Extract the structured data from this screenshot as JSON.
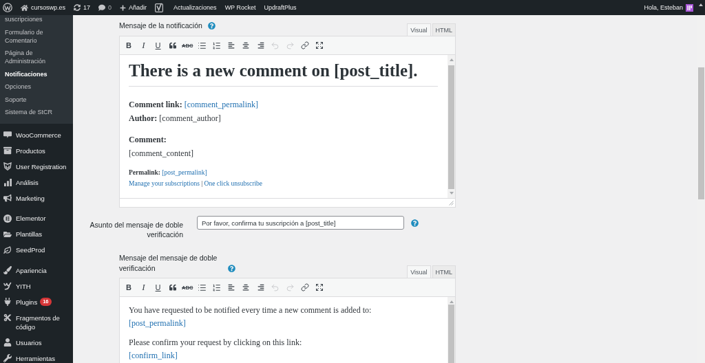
{
  "admin_bar": {
    "site_name": "cursoswp.es",
    "updates": "17",
    "comments": "0",
    "new_label": "Añadir",
    "links": [
      "Actualizaciones",
      "WP Rocket",
      "UpdraftPlus"
    ],
    "greeting": "Hola, Esteban"
  },
  "sidebar": {
    "submenu": [
      {
        "label": "suscripciones",
        "selected": false
      },
      {
        "label": "Formulario de Comentario",
        "selected": false
      },
      {
        "label": "Página de Administración",
        "selected": false
      },
      {
        "label": "Notificaciones",
        "selected": true
      },
      {
        "label": "Opciones",
        "selected": false
      },
      {
        "label": "Soporte",
        "selected": false
      },
      {
        "label": "Sistema de StCR",
        "selected": false
      }
    ],
    "menu_groups": [
      [
        {
          "label": "WooCommerce"
        },
        {
          "label": "Productos"
        },
        {
          "label": "User Registration"
        },
        {
          "label": "Análisis"
        },
        {
          "label": "Marketing"
        }
      ],
      [
        {
          "label": "Elementor"
        },
        {
          "label": "Plantillas"
        },
        {
          "label": "SeedProd"
        }
      ],
      [
        {
          "label": "Apariencia"
        },
        {
          "label": "YITH"
        },
        {
          "label": "Plugins",
          "badge": "16"
        },
        {
          "label": "Fragmentos de código"
        },
        {
          "label": "Usuarios"
        },
        {
          "label": "Herramientas"
        }
      ]
    ]
  },
  "notification_message": {
    "label": "Mensaje de la notificación",
    "tabs": [
      {
        "label": "Visual",
        "selected": true
      },
      {
        "label": "HTML",
        "selected": false
      }
    ],
    "toolbar": [
      {
        "kind": "bold",
        "label": "B",
        "disabled": false
      },
      {
        "kind": "italic",
        "label": "I",
        "disabled": false
      },
      {
        "kind": "underline",
        "label": "U",
        "disabled": false
      },
      {
        "kind": "quote",
        "disabled": false
      },
      {
        "kind": "strikethrough",
        "label": "ABC",
        "disabled": false
      },
      {
        "kind": "bullet_list",
        "disabled": false
      },
      {
        "kind": "numbered_list",
        "disabled": false
      },
      {
        "kind": "align_left",
        "disabled": false
      },
      {
        "kind": "align_center",
        "disabled": false
      },
      {
        "kind": "align_right",
        "disabled": false
      },
      {
        "kind": "undo",
        "disabled": true
      },
      {
        "kind": "redo",
        "disabled": true
      },
      {
        "kind": "link",
        "disabled": false
      },
      {
        "kind": "fullscreen",
        "disabled": false
      }
    ],
    "blocks": [
      {
        "kind": "heading",
        "text": "There is a new comment on [post_title]."
      },
      {
        "kind": "rule"
      },
      {
        "kind": "paragraph",
        "lines": [
          [
            {
              "kind": "label",
              "text": "Comment link:"
            },
            {
              "kind": "link",
              "text": "[comment_permalink]"
            }
          ],
          [
            {
              "kind": "text",
              "text": "**Author:** [comment_author]"
            }
          ]
        ]
      },
      {
        "kind": "paragraph",
        "lines": [
          [
            {
              "kind": "label",
              "text": "Comment:"
            }
          ],
          [
            {
              "kind": "text",
              "text": "[comment_content]"
            }
          ]
        ]
      },
      {
        "kind": "small",
        "lines": [
          [
            {
              "kind": "label",
              "text": "Permalink:"
            },
            {
              "kind": "link",
              "text": "[post_permalink]"
            }
          ],
          [
            {
              "kind": "link",
              "text": "Manage your subscriptions"
            },
            {
              "kind": "text",
              "text": "|"
            },
            {
              "kind": "link",
              "text": "One click unsubscribe"
            }
          ]
        ]
      }
    ]
  },
  "confirmation_subject": {
    "label": "Asunto del mensaje de doble verificación",
    "value": "Por favor, confirma tu suscripción a [post_title]"
  },
  "confirmation_message": {
    "label": "Mensaje del mensaje de doble verificación",
    "tabs": [
      {
        "label": "Visual",
        "selected": true
      },
      {
        "label": "HTML",
        "selected": false
      }
    ],
    "toolbar": [
      {
        "kind": "bold",
        "label": "B",
        "disabled": false
      },
      {
        "kind": "italic",
        "label": "I",
        "disabled": false
      },
      {
        "kind": "underline",
        "label": "U",
        "disabled": false
      },
      {
        "kind": "quote",
        "disabled": false
      },
      {
        "kind": "strikethrough",
        "label": "ABC",
        "disabled": false
      },
      {
        "kind": "bullet_list",
        "disabled": false
      },
      {
        "kind": "numbered_list",
        "disabled": false
      },
      {
        "kind": "align_left",
        "disabled": false
      },
      {
        "kind": "align_center",
        "disabled": false
      },
      {
        "kind": "align_right",
        "disabled": false
      },
      {
        "kind": "undo",
        "disabled": true
      },
      {
        "kind": "redo",
        "disabled": true
      },
      {
        "kind": "link",
        "disabled": false
      },
      {
        "kind": "fullscreen",
        "disabled": false
      }
    ],
    "blocks": [
      {
        "kind": "paragraph",
        "lines": [
          [
            {
              "kind": "text",
              "text": "You have requested to be notified every time a new comment is added to:"
            }
          ],
          [
            {
              "kind": "link",
              "text": "[post_permalink]"
            }
          ]
        ]
      },
      {
        "kind": "paragraph",
        "lines": [
          [
            {
              "kind": "text",
              "text": "Please confirm your request by clicking on this link:"
            }
          ],
          [
            {
              "kind": "link",
              "text": "[confirm_link]"
            }
          ]
        ]
      }
    ]
  }
}
